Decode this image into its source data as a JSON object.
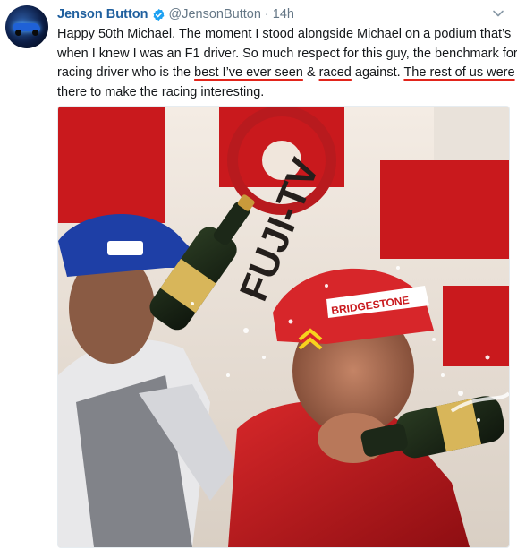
{
  "tweet": {
    "display_name": "Jenson Button",
    "handle": "@JensonButton",
    "separator": "·",
    "time": "14h",
    "text_lines": [
      [
        "Happy 50th Michael. The moment I stood alongside Michael on a podium that’s"
      ],
      [
        "when I knew I was an F1 driver. So much respect for this guy, the benchmark for a"
      ],
      [
        "racing driver who is the ",
        "best I’ve ever seen",
        " & ",
        "raced",
        " against. ",
        "The rest of us were"
      ],
      [
        "there to make the racing interesting."
      ]
    ]
  },
  "photo": {
    "backdrop_text": "FUJI-TV",
    "cap_sponsor": "BRIDGESTONE",
    "bottle_label": "Champagne"
  },
  "icons": {
    "verified": "verified-badge-icon",
    "more": "chevron-down-icon"
  },
  "colors": {
    "name": "#1f5f9e",
    "muted": "#657786",
    "verified": "#1da1f2",
    "annotation": "#e2241b"
  }
}
